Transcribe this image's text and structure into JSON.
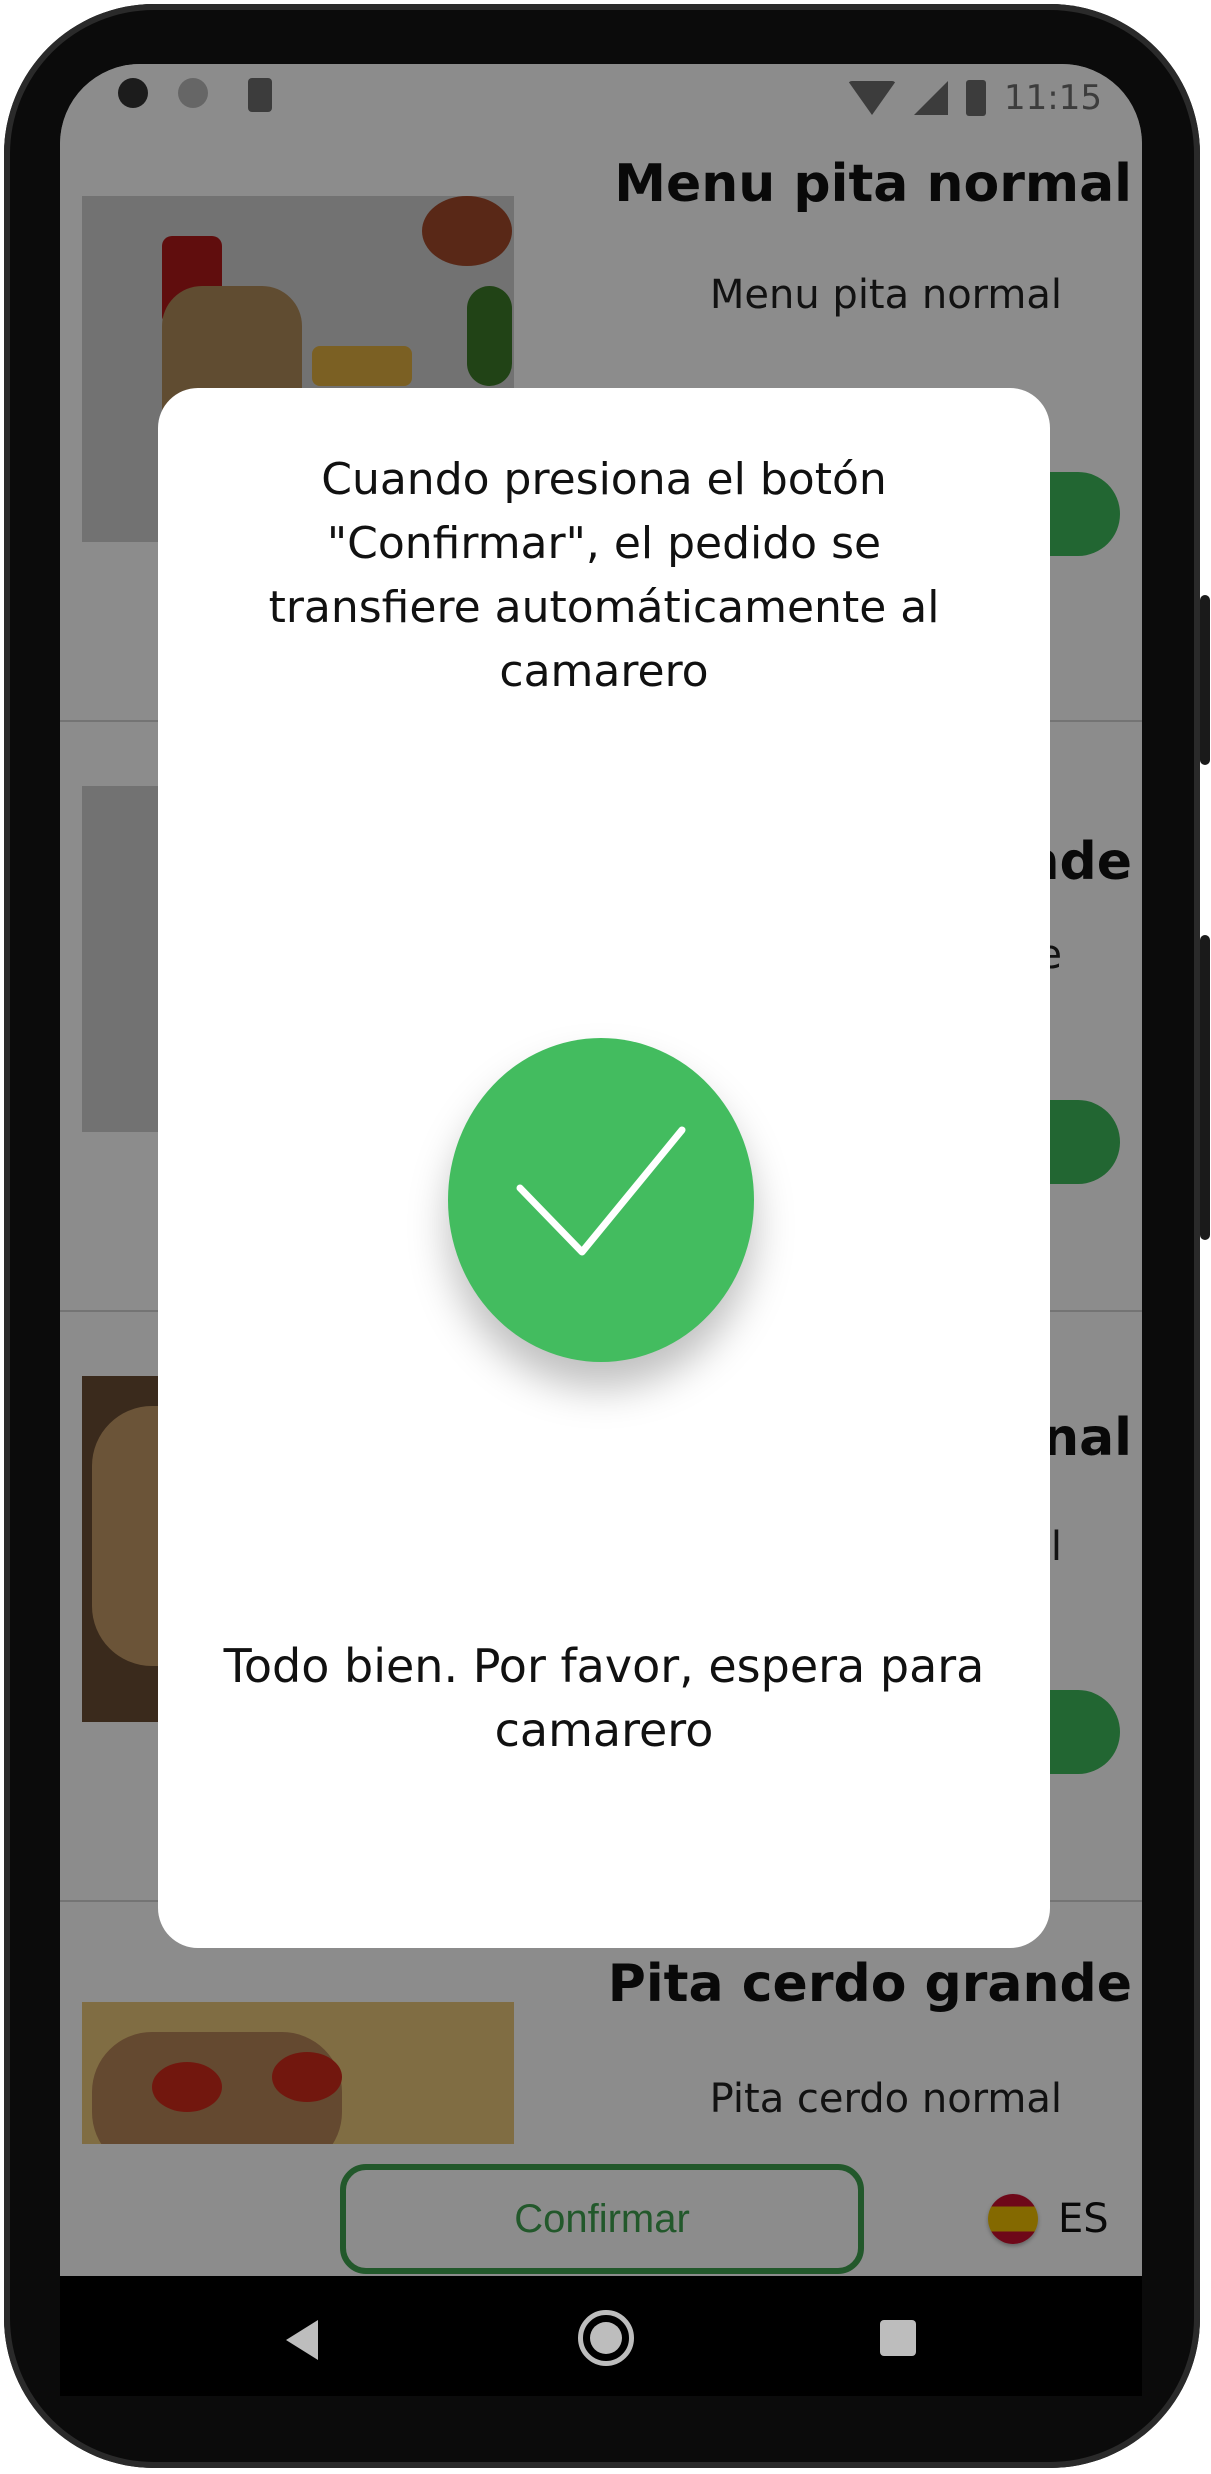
{
  "status_bar": {
    "time": "11:15"
  },
  "menu_items": [
    {
      "title": "Menu pita normal",
      "description": "Menu pita normal"
    },
    {
      "title": "…nde",
      "description": "…e"
    },
    {
      "title": "…nal",
      "description": "…l"
    },
    {
      "title": "Pita cerdo grande",
      "description": "Pita cerdo normal"
    }
  ],
  "bottom_bar": {
    "confirm_label": "Confirmar",
    "language": "ES"
  },
  "dialog": {
    "info_text": "Cuando presiona el botón \"Confirmar\", el pedido se transfiere automáticamente al camarero",
    "success_text": "Todo bien. Por favor, espera para camarero"
  },
  "colors": {
    "accent_green": "#43bc5f",
    "confirm_green": "#3fa04f"
  },
  "icons": {
    "success": "check-icon",
    "flag": "spain-flag-icon"
  }
}
